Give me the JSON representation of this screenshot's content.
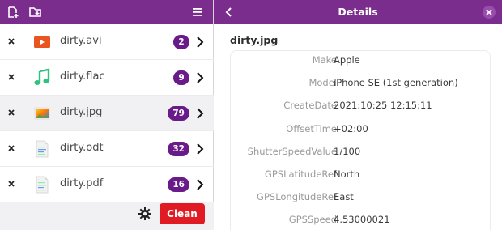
{
  "left_header": {
    "add_file_icon": "add-file-icon",
    "add_folder_icon": "add-folder-icon",
    "menu_icon": "hamburger-menu-icon"
  },
  "files": [
    {
      "name": "dirty.avi",
      "count": "2",
      "icon": "video-file-icon",
      "selected": false
    },
    {
      "name": "dirty.flac",
      "count": "9",
      "icon": "audio-file-icon",
      "selected": false
    },
    {
      "name": "dirty.jpg",
      "count": "79",
      "icon": "image-file-icon",
      "selected": true
    },
    {
      "name": "dirty.odt",
      "count": "32",
      "icon": "document-file-icon",
      "selected": false
    },
    {
      "name": "dirty.pdf",
      "count": "16",
      "icon": "document-file-icon",
      "selected": false
    }
  ],
  "footer": {
    "clean_label": "Clean"
  },
  "details": {
    "title": "Details",
    "file_name": "dirty.jpg",
    "metadata": [
      {
        "key": "Make",
        "value": "Apple"
      },
      {
        "key": "Model",
        "value": "iPhone SE (1st generation)"
      },
      {
        "key": "CreateDate",
        "value": "2021:10:25 12:15:11"
      },
      {
        "key": "OffsetTime",
        "value": "+02:00"
      },
      {
        "key": "ShutterSpeedValue",
        "value": "1/100"
      },
      {
        "key": "GPSLatitudeRef",
        "value": "North"
      },
      {
        "key": "GPSLongitudeRef",
        "value": "East"
      },
      {
        "key": "GPSSpeed",
        "value": "4.53000021"
      }
    ]
  },
  "colors": {
    "header": "#7b2d8e",
    "badge": "#6a1b8a",
    "clean_button": "#e01b24"
  }
}
